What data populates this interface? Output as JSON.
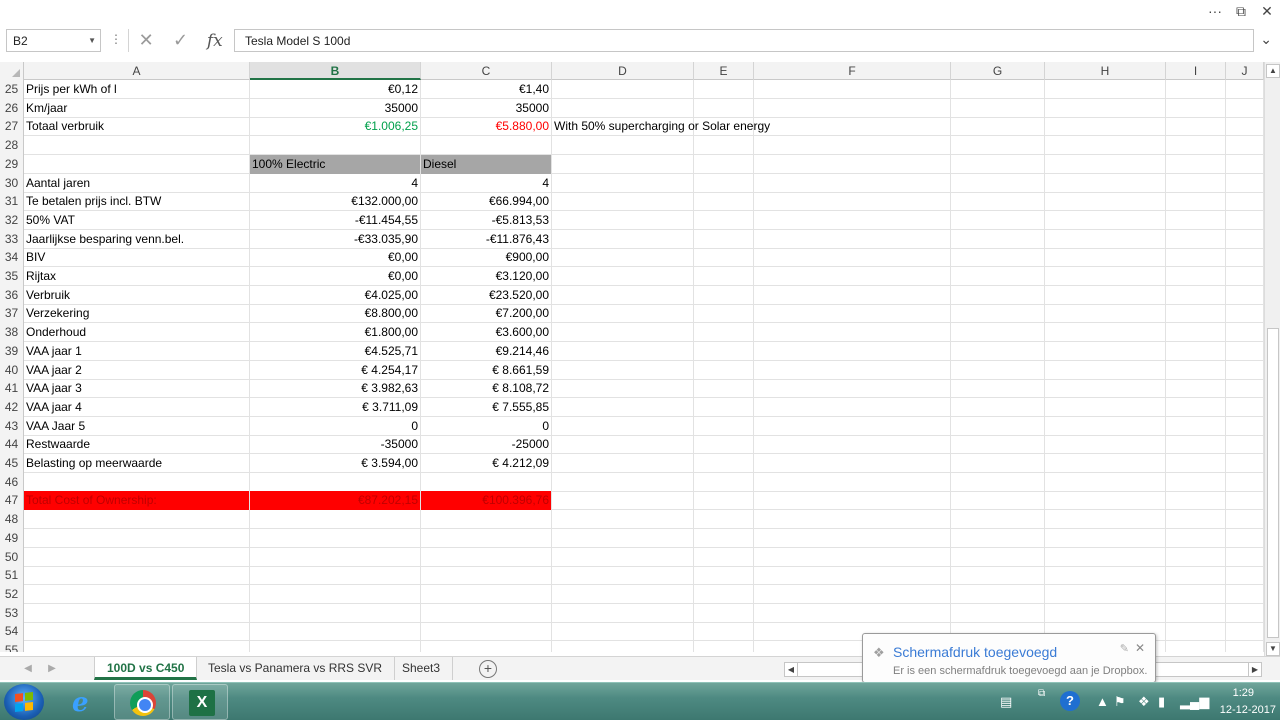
{
  "window": {
    "more_label": "···",
    "restore_label": "⧉",
    "close_label": "✕"
  },
  "formula_bar": {
    "name_box": "B2",
    "content": "Tesla Model S 100d"
  },
  "columns": [
    "A",
    "B",
    "C",
    "D",
    "E",
    "F",
    "G",
    "H",
    "I",
    "J"
  ],
  "rows": [
    {
      "num": "25",
      "A": "Prijs per kWh of l",
      "B": "€0,12",
      "C": "€1,40"
    },
    {
      "num": "26",
      "A": "Km/jaar",
      "B": "35000",
      "C": "35000"
    },
    {
      "num": "27",
      "A": "Totaal verbruik",
      "B": "€1.006,25",
      "C": "€5.880,00",
      "D": "With 50% supercharging or Solar energy"
    },
    {
      "num": "28"
    },
    {
      "num": "29",
      "B": "100% Electric",
      "C": "Diesel"
    },
    {
      "num": "30",
      "A": "Aantal jaren",
      "B": "4",
      "C": "4"
    },
    {
      "num": "31",
      "A": "Te betalen prijs incl. BTW",
      "B": "€132.000,00",
      "C": "€66.994,00"
    },
    {
      "num": "32",
      "A": "50% VAT",
      "B": "-€11.454,55",
      "C": "-€5.813,53"
    },
    {
      "num": "33",
      "A": "Jaarlijkse besparing venn.bel.",
      "B": "-€33.035,90",
      "C": "-€11.876,43"
    },
    {
      "num": "34",
      "A": "BIV",
      "B": "€0,00",
      "C": "€900,00"
    },
    {
      "num": "35",
      "A": "Rijtax",
      "B": "€0,00",
      "C": "€3.120,00"
    },
    {
      "num": "36",
      "A": "Verbruik",
      "B": "€4.025,00",
      "C": "€23.520,00"
    },
    {
      "num": "37",
      "A": "Verzekering",
      "B": "€8.800,00",
      "C": "€7.200,00"
    },
    {
      "num": "38",
      "A": "Onderhoud",
      "B": "€1.800,00",
      "C": "€3.600,00"
    },
    {
      "num": "39",
      "A": "VAA jaar 1",
      "B": "€4.525,71",
      "C": "€9.214,46"
    },
    {
      "num": "40",
      "A": "VAA jaar 2",
      "B": "€ 4.254,17",
      "C": "€ 8.661,59"
    },
    {
      "num": "41",
      "A": "VAA jaar 3",
      "B": "€ 3.982,63",
      "C": "€ 8.108,72"
    },
    {
      "num": "42",
      "A": "VAA jaar 4",
      "B": "€ 3.711,09",
      "C": "€ 7.555,85"
    },
    {
      "num": "43",
      "A": "VAA Jaar 5",
      "B": "0",
      "C": "0"
    },
    {
      "num": "44",
      "A": "Restwaarde",
      "B": "-35000",
      "C": "-25000"
    },
    {
      "num": "45",
      "A": "Belasting op meerwaarde",
      "B": "€ 3.594,00",
      "C": "€ 4.212,09"
    },
    {
      "num": "46"
    },
    {
      "num": "47",
      "A": "Total Cost of Ownership:",
      "B": "€87.202,15",
      "C": "€100.396,76"
    },
    {
      "num": "48"
    },
    {
      "num": "49"
    },
    {
      "num": "50"
    },
    {
      "num": "51"
    },
    {
      "num": "52"
    },
    {
      "num": "53"
    },
    {
      "num": "54"
    },
    {
      "num": "55"
    }
  ],
  "styles": {
    "row_27_B_color": "#00a04b",
    "row_27_C_color": "#ff0000",
    "row_29_fill": "#a6a6a6",
    "row_47_fill": "#ff0000",
    "row_47_text": "#c00000",
    "accent": "#217346"
  },
  "sheet_tabs": [
    {
      "label": "100D vs C450",
      "active": true
    },
    {
      "label": "Tesla vs Panamera vs RRS SVR",
      "active": false
    },
    {
      "label": "Sheet3",
      "active": false
    }
  ],
  "toast": {
    "title": "Schermafdruk toegevoegd",
    "body": "Er is een schermafdruk toegevoegd aan je Dropbox."
  },
  "taskbar": {
    "icons": [
      "windows-start-icon",
      "internet-explorer-icon",
      "chrome-icon",
      "excel-icon"
    ],
    "clock_time": "1:29",
    "clock_date": "12-12-2017"
  }
}
